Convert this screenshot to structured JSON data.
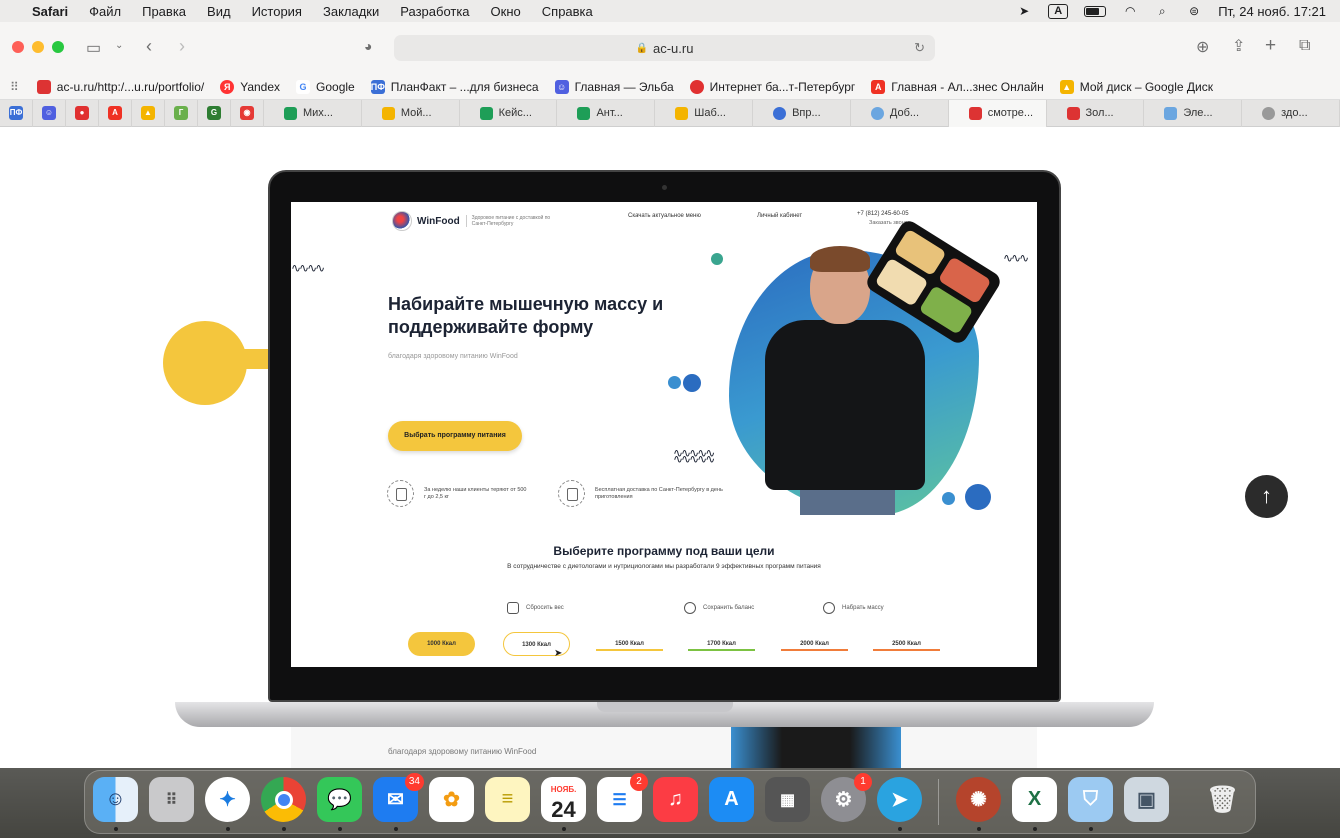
{
  "menubar": {
    "app": "Safari",
    "items": [
      "Файл",
      "Правка",
      "Вид",
      "История",
      "Закладки",
      "Разработка",
      "Окно",
      "Справка"
    ],
    "datetime": "Пт, 24 нояб.  17:21",
    "input_indicator": "A"
  },
  "browser": {
    "url": "ac-u.ru",
    "favorites": [
      {
        "label": "ac-u.ru/http:/...u.ru/portfolio/",
        "color": "#d33"
      },
      {
        "label": "Yandex",
        "color": "#f33"
      },
      {
        "label": "Google",
        "color": "#4285f4"
      },
      {
        "label": "ПланФакт – ...для бизнеса",
        "color": "#3b6fd6"
      },
      {
        "label": "Главная — Эльба",
        "color": "#5060e0"
      },
      {
        "label": "Интернет ба...т-Петербург",
        "color": "#e03030"
      },
      {
        "label": "Главная - Ал...знес Онлайн",
        "color": "#ef3124"
      },
      {
        "label": "Мой диск – Google Диск",
        "color": "#f4b400"
      }
    ],
    "pinned_tabs": [
      {
        "label": "ПФ",
        "color": "#3b6fd6"
      },
      {
        "label": "☺",
        "color": "#5060e0"
      },
      {
        "label": "●",
        "color": "#e03030"
      },
      {
        "label": "А",
        "color": "#ef3124"
      },
      {
        "label": "▲",
        "color": "#f4b400"
      },
      {
        "label": "Г",
        "color": "#6ab04c"
      },
      {
        "label": "G",
        "color": "#2e7d32"
      },
      {
        "label": "◉",
        "color": "#e53935"
      }
    ],
    "tabs": [
      {
        "label": "Мих...",
        "color": "#1e9e57",
        "active": false
      },
      {
        "label": "Мой...",
        "color": "#f4b400",
        "active": false
      },
      {
        "label": "Кейс...",
        "color": "#1e9e57",
        "active": false
      },
      {
        "label": "Ант...",
        "color": "#1e9e57",
        "active": false
      },
      {
        "label": "Шаб...",
        "color": "#f4b400",
        "active": false
      },
      {
        "label": "Впр...",
        "color": "#3b6fd6",
        "active": false
      },
      {
        "label": "Доб...",
        "color": "#6ba6e0",
        "active": false
      },
      {
        "label": "смотре...",
        "color": "#d33",
        "active": true
      },
      {
        "label": "Зол...",
        "color": "#d33",
        "active": false
      },
      {
        "label": "Эле...",
        "color": "#6ba6e0",
        "active": false
      },
      {
        "label": "здо...",
        "color": "#999",
        "active": false
      }
    ]
  },
  "site": {
    "logo_name": "WinFood",
    "logo_tagline": "Здоровое питание с доставкой по Санкт-Петербургу",
    "nav_menu": "Скачать актуальное меню",
    "nav_cabinet": "Личный кабинет",
    "phone": "+7 (812) 245-60-05",
    "callback": "Заказать звонок",
    "headline": "Набирайте мышечную массу и поддерживайте форму",
    "subheadline": "благодаря здоровому питанию WinFood",
    "cta": "Выбрать программу питания",
    "feature_1": "За неделю наши клиенты теряют от 500 г до 2,5 кг",
    "feature_2": "Бесплатная доставка по Санкт-Петербургу в день приготовления",
    "programs_title": "Выберите программу под ваши цели",
    "programs_subtitle": "В сотрудничестве с диетологами и нутрициологами мы разработали 9 эффективных программ питания",
    "goals": [
      "Сбросить вес",
      "Сохранить баланс",
      "Набрать массу"
    ],
    "calories": [
      {
        "label": "1000 Ккал",
        "style": "selected",
        "color": "#f4c63d"
      },
      {
        "label": "1300 Ккал",
        "style": "outline",
        "color": "#f4c63d"
      },
      {
        "label": "1500 Ккал",
        "style": "line",
        "color": "#f4c63d"
      },
      {
        "label": "1700 Ккал",
        "style": "line",
        "color": "#7cc242"
      },
      {
        "label": "2000 Ккал",
        "style": "line",
        "color": "#f07c3a"
      },
      {
        "label": "2500 Ккал",
        "style": "line",
        "color": "#f07c3a"
      }
    ],
    "reflection_text": "благодаря здоровому питанию WinFood"
  },
  "dock": {
    "calendar_month": "НОЯБ.",
    "calendar_day": "24",
    "mail_badge": "34",
    "reminders_badge": "2",
    "settings_badge": "1"
  }
}
